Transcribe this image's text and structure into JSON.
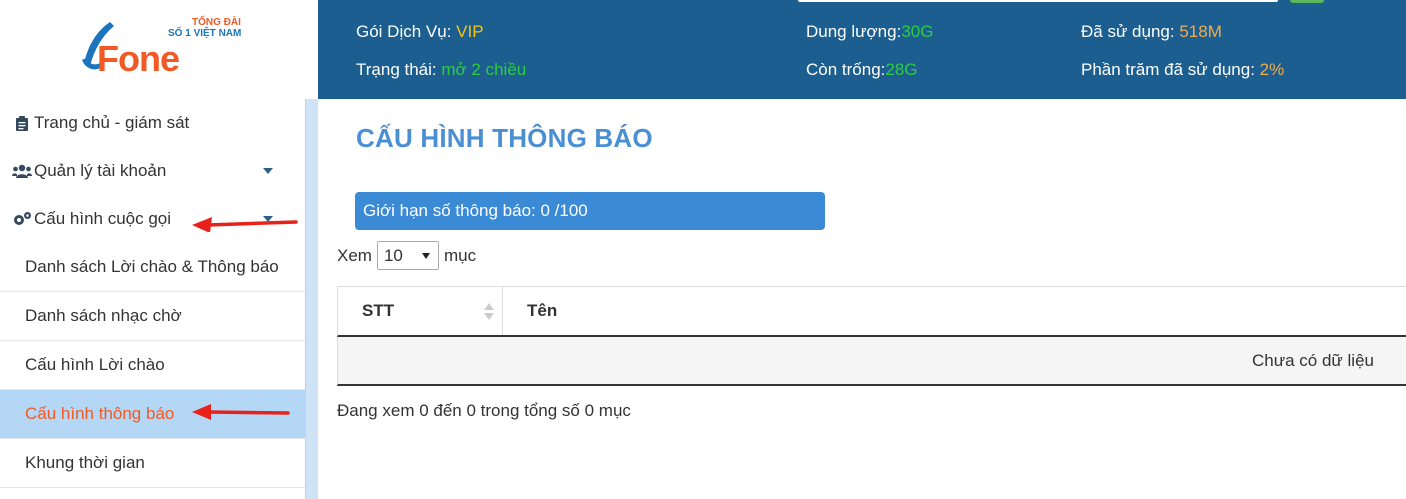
{
  "logo": {
    "brand": "Fone",
    "tagline_top": "TỔNG ĐÀI",
    "tagline_sub": "SỐ 1 VIỆT NAM",
    "brand_color": "#f15a24",
    "accent_color": "#1c75bc"
  },
  "header": {
    "service_label": "Gói Dịch Vụ:",
    "service_value": "VIP",
    "status_label": "Trạng thái:",
    "status_value": "mở 2 chiều",
    "capacity_label": "Dung lượng:",
    "capacity_value": "30G",
    "free_label": "Còn trống:",
    "free_value": "28G",
    "used_label": "Đã sử dụng:",
    "used_value": "518M",
    "percent_label": "Phần trăm đã sử dụng:",
    "percent_value": "2%"
  },
  "sidebar": {
    "items": [
      {
        "label": "Trang chủ - giám sát",
        "icon": "clipboard-icon"
      },
      {
        "label": "Quản lý tài khoản",
        "icon": "users-icon"
      },
      {
        "label": "Cấu hình cuộc gọi",
        "icon": "gears-icon"
      }
    ],
    "subitems": [
      {
        "label": "Danh sách Lời chào & Thông báo"
      },
      {
        "label": "Danh sách nhạc chờ"
      },
      {
        "label": "Cấu hình Lời chào"
      },
      {
        "label": "Cấu hình thông báo"
      },
      {
        "label": "Khung thời gian"
      }
    ]
  },
  "main": {
    "title": "CẤU HÌNH THÔNG BÁO",
    "limit_label": "Giới hạn số thông báo:",
    "limit_value": "0 /100",
    "show_prefix": "Xem",
    "page_size": "10",
    "show_suffix": "mục",
    "table": {
      "columns": [
        "STT",
        "Tên"
      ],
      "empty_text": "Chưa có dữ liệu"
    },
    "info_text": "Đang xem 0 đến 0 trong tổng số 0 mục"
  },
  "colors": {
    "header_bg": "#1b5e8f",
    "active_bg": "#b3d7f5",
    "active_text": "#f15a24",
    "title_color": "#4a8fd4",
    "limit_bg": "#3a8ad6",
    "arrow_color": "#e8221b"
  }
}
